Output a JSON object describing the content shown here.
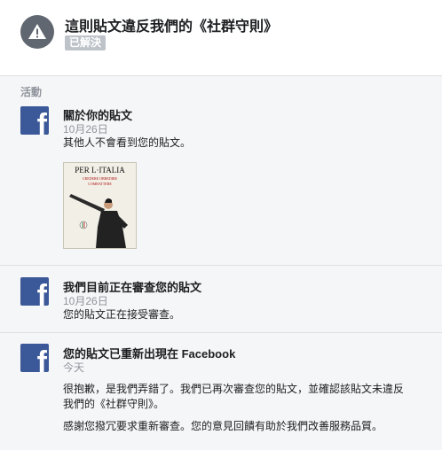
{
  "header": {
    "icon": "warning-icon",
    "title": "這則貼文違反我們的《社群守則》",
    "status_badge": "已解決"
  },
  "activity": {
    "section_label": "活動",
    "items": [
      {
        "icon": "facebook-logo-icon",
        "title": "關於你的貼文",
        "date": "10月26日",
        "text": "其他人不會看到您的貼文。",
        "thumbnail": {
          "headline": "PER L·ITALIA",
          "subline_1": "CREDERE OBBEDIRE",
          "subline_2": "COMBATTERE"
        }
      },
      {
        "icon": "facebook-logo-icon",
        "title": "我們目前正在審查您的貼文",
        "date": "10月26日",
        "text": "您的貼文正在接受審查。"
      },
      {
        "icon": "facebook-logo-icon",
        "title": "您的貼文已重新出現在 Facebook",
        "date": "今天",
        "text_1": "很抱歉，是我們弄錯了。我們已再次審查您的貼文，並確認該貼文未違反我們的《社群守則》。",
        "text_2": "感謝您撥冗要求重新審查。您的意見回饋有助於我們改善服務品質。"
      }
    ]
  },
  "colors": {
    "facebook_blue": "#3b5998",
    "badge_gray": "#bec3c9",
    "warning_gray": "#606770",
    "meta_gray": "#90949c"
  }
}
